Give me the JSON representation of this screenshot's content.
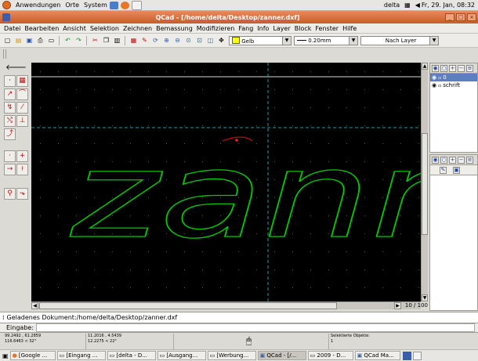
{
  "top_panel": {
    "menus": [
      "Anwendungen",
      "Orte",
      "System"
    ],
    "user": "delta",
    "clock": "Fr, 29. Jan, 08:32"
  },
  "window": {
    "title": "QCad - [/home/delta/Desktop/zanner.dxf]",
    "controls": [
      "_",
      "□",
      "×"
    ]
  },
  "menubar": {
    "items": [
      "Datei",
      "Bearbeiten",
      "Ansicht",
      "Selektion",
      "Zeichnen",
      "Bemassung",
      "Modifizieren",
      "Fang",
      "Info",
      "Layer",
      "Block",
      "Fenster",
      "Hilfe"
    ]
  },
  "toolbar": {
    "color_value": "Gelb",
    "lineweight_value": "0.20mm",
    "linetype_value": "Nach Layer",
    "color_hex": "#ffff00"
  },
  "drawing": {
    "text": "zann",
    "background": "#000000",
    "stroke": "#00cc00",
    "crosshair": "#1aa0a0"
  },
  "scroll": {
    "page_count": "10 / 100"
  },
  "layers": {
    "items": [
      {
        "name": "0",
        "selected": true
      },
      {
        "name": "schrift",
        "selected": false
      }
    ]
  },
  "command": {
    "history": "Geladenes Dokument:/home/delta/Desktop/zanner.dxf",
    "prompt": "Eingabe:"
  },
  "status": {
    "abs_coord": "99.2492 , 61.2859",
    "abs_polar": "116.6463 < 32°",
    "rel_coord": "11.2016 , 4.5439",
    "rel_polar": "12.2275 < 22°",
    "selected_label": "Selektierte Objekte:",
    "selected_count": "1"
  },
  "taskbar": {
    "items": [
      "[Google ...",
      "[Eingang ...",
      "[delta - D...",
      "[Ausgang...",
      "[Werbung...",
      "QCad - [/...",
      "2009 - D...",
      "QCad Ma..."
    ]
  }
}
